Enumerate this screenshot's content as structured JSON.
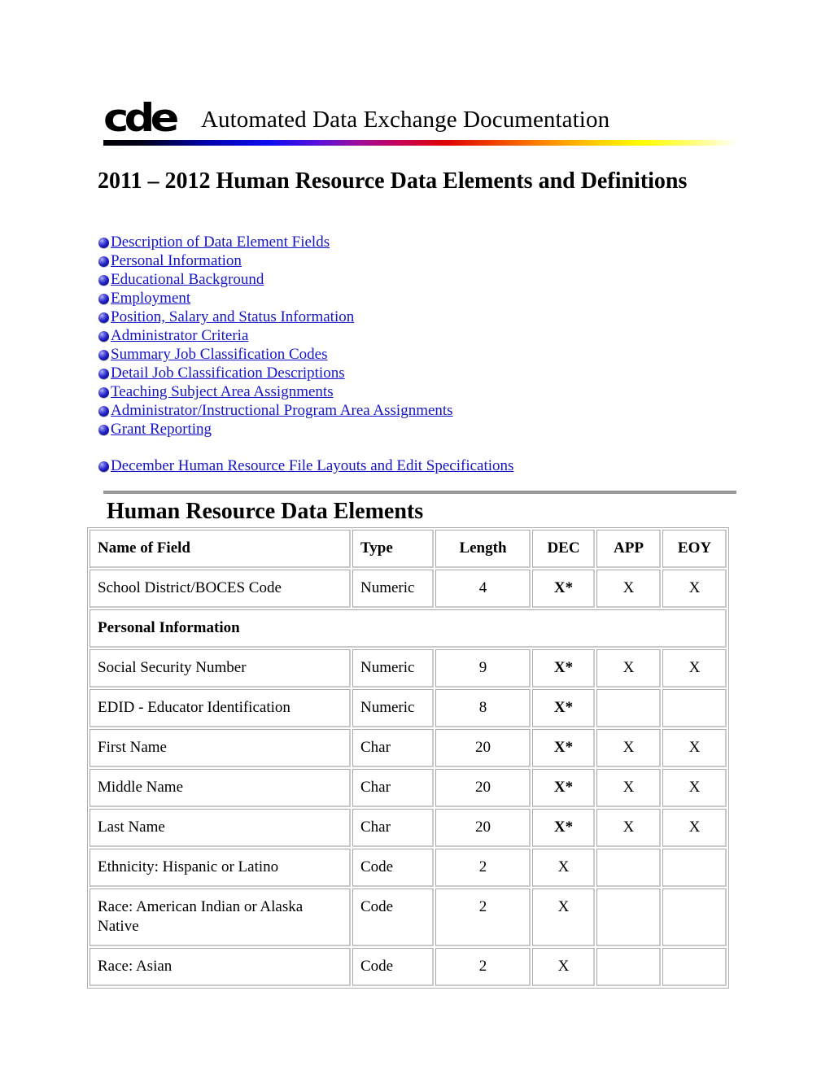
{
  "masthead": {
    "logo_text": "cde",
    "logo_name": "cde-logo",
    "title": "Automated Data Exchange Documentation"
  },
  "document": {
    "title": "2011 – 2012 Human Resource Data Elements and Definitions"
  },
  "links": {
    "primary": [
      {
        "label": "Description of Data Element Fields"
      },
      {
        "label": "Personal Information"
      },
      {
        "label": "Educational Background"
      },
      {
        "label": "Employment"
      },
      {
        "label": "Position, Salary and Status Information"
      },
      {
        "label": "Administrator Criteria"
      },
      {
        "label": "Summary Job Classification Codes"
      },
      {
        "label": "Detail Job Classification Descriptions"
      },
      {
        "label": "Teaching Subject Area Assignments"
      },
      {
        "label": "Administrator/Instructional Program Area Assignments"
      },
      {
        "label": "Grant Reporting"
      }
    ],
    "secondary": [
      {
        "label": "December Human Resource File Layouts and Edit Specifications"
      }
    ]
  },
  "section": {
    "heading": "Human Resource Data Elements"
  },
  "table": {
    "headers": {
      "name": "Name of Field",
      "type": "Type",
      "length": "Length",
      "dec": "DEC",
      "app": "APP",
      "eoy": "EOY"
    },
    "rows": [
      {
        "kind": "data",
        "name": "School District/BOCES Code",
        "type": "Numeric",
        "length": "4",
        "dec": "X*",
        "app": "X",
        "eoy": "X"
      },
      {
        "kind": "section",
        "name": "Personal Information"
      },
      {
        "kind": "data",
        "name": "Social Security Number",
        "type": "Numeric",
        "length": "9",
        "dec": "X*",
        "app": "X",
        "eoy": "X"
      },
      {
        "kind": "data",
        "name": "EDID - Educator Identification",
        "type": "Numeric",
        "length": "8",
        "dec": "X*",
        "app": "",
        "eoy": ""
      },
      {
        "kind": "data",
        "name": "First Name",
        "type": "Char",
        "length": "20",
        "dec": "X*",
        "app": "X",
        "eoy": "X"
      },
      {
        "kind": "data",
        "name": "Middle Name",
        "type": "Char",
        "length": "20",
        "dec": "X*",
        "app": "X",
        "eoy": "X"
      },
      {
        "kind": "data",
        "name": "Last Name",
        "type": "Char",
        "length": "20",
        "dec": "X*",
        "app": "X",
        "eoy": "X"
      },
      {
        "kind": "data",
        "name": "Ethnicity: Hispanic or Latino",
        "type": "Code",
        "length": "2",
        "dec": "X",
        "app": "",
        "eoy": ""
      },
      {
        "kind": "data",
        "name": "Race: American Indian or Alaska Native",
        "type": "Code",
        "length": "2",
        "dec": "X",
        "app": "",
        "eoy": ""
      },
      {
        "kind": "data",
        "name": "Race: Asian",
        "type": "Code",
        "length": "2",
        "dec": "X",
        "app": "",
        "eoy": ""
      }
    ]
  },
  "colors": {
    "link": "#1515c8",
    "bullet": "#2020c8",
    "rule": "#9a9a9a",
    "table_border": "#c9c9c9"
  }
}
